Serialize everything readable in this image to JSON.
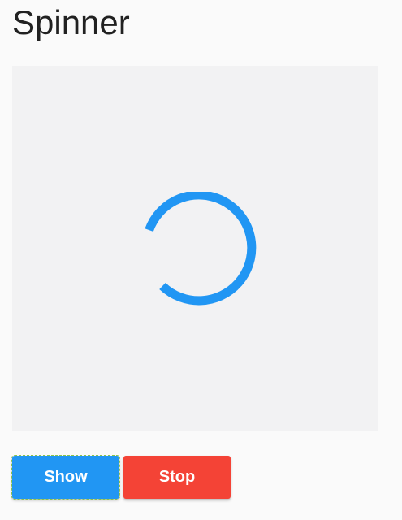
{
  "page": {
    "title": "Spinner"
  },
  "spinner": {
    "icon": "circular-progress-spinner",
    "color": "#2196f3",
    "panel_background": "#f2f2f3"
  },
  "buttons": {
    "show_label": "Show",
    "show_color": "#2196f3",
    "stop_label": "Stop",
    "stop_color": "#f44336"
  }
}
